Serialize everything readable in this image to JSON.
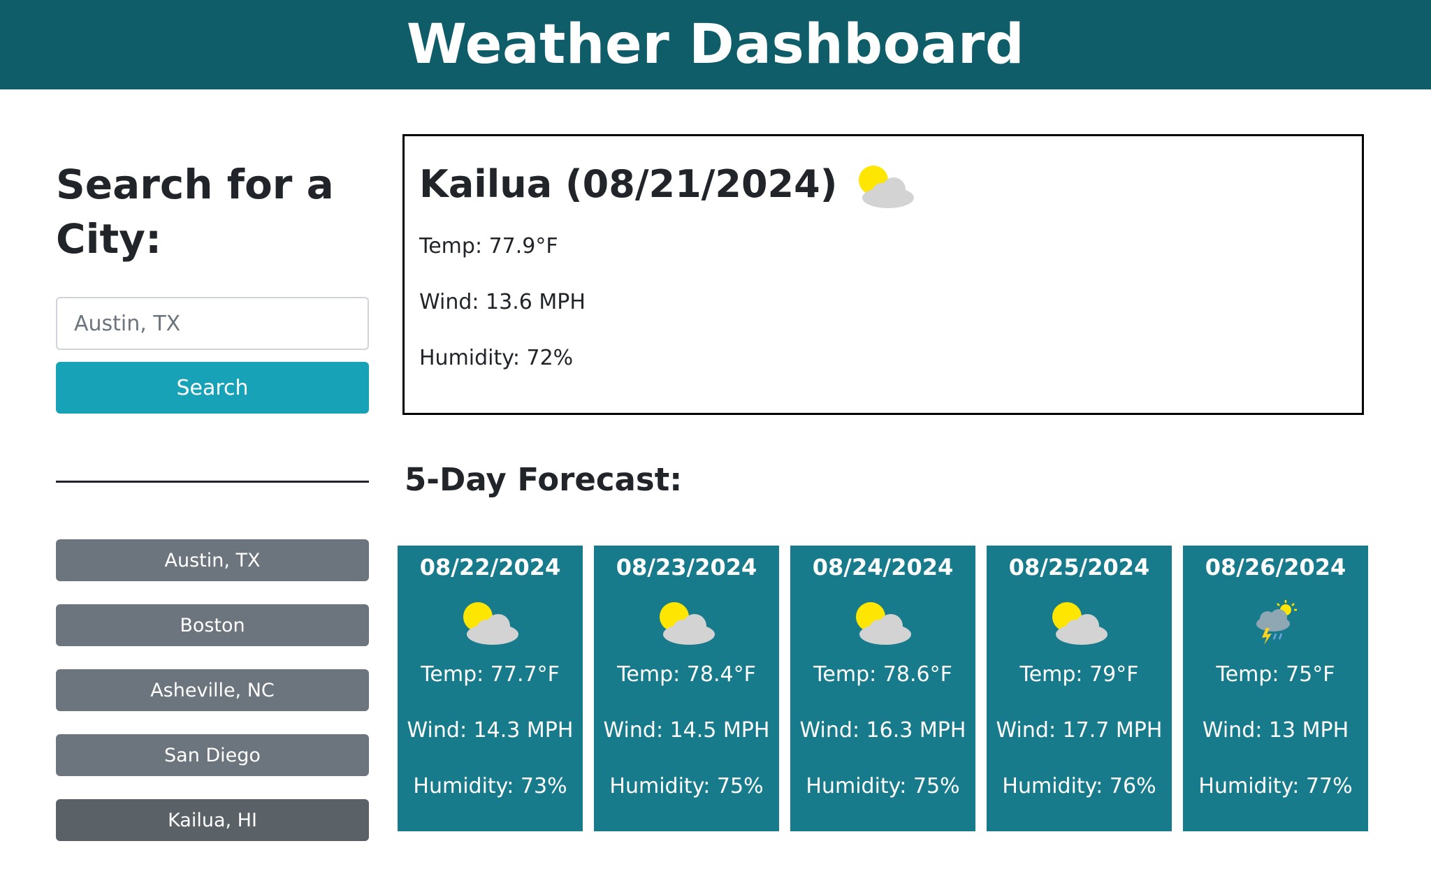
{
  "header": {
    "title": "Weather Dashboard"
  },
  "search": {
    "title": "Search for a City:",
    "placeholder": "Austin, TX",
    "button_label": "Search"
  },
  "history": [
    {
      "label": "Austin, TX"
    },
    {
      "label": "Boston"
    },
    {
      "label": "Asheville, NC"
    },
    {
      "label": "San Diego"
    },
    {
      "label": "Kailua, HI"
    }
  ],
  "current": {
    "title": "Kailua (08/21/2024)",
    "icon": "partly-cloudy-icon",
    "temp": "Temp: 77.9°F",
    "wind": "Wind: 13.6 MPH",
    "humidity": "Humidity: 72%"
  },
  "forecast": {
    "title": "5-Day Forecast:",
    "days": [
      {
        "date": "08/22/2024",
        "icon": "partly-cloudy-icon",
        "temp": "Temp: 77.7°F",
        "wind": "Wind: 14.3 MPH",
        "humidity": "Humidity: 73%"
      },
      {
        "date": "08/23/2024",
        "icon": "partly-cloudy-icon",
        "temp": "Temp: 78.4°F",
        "wind": "Wind: 14.5 MPH",
        "humidity": "Humidity: 75%"
      },
      {
        "date": "08/24/2024",
        "icon": "partly-cloudy-icon",
        "temp": "Temp: 78.6°F",
        "wind": "Wind: 16.3 MPH",
        "humidity": "Humidity: 75%"
      },
      {
        "date": "08/25/2024",
        "icon": "partly-cloudy-icon",
        "temp": "Temp: 79°F",
        "wind": "Wind: 17.7 MPH",
        "humidity": "Humidity: 76%"
      },
      {
        "date": "08/26/2024",
        "icon": "thunderstorm-icon",
        "temp": "Temp: 75°F",
        "wind": "Wind: 13 MPH",
        "humidity": "Humidity: 77%"
      }
    ]
  },
  "colors": {
    "header_bg": "#0e5d69",
    "search_button": "#17a2b8",
    "history_button": "#6c757d",
    "card_bg": "#177b8c",
    "sun": "#ffe600",
    "cloud": "#d3d3d3"
  }
}
